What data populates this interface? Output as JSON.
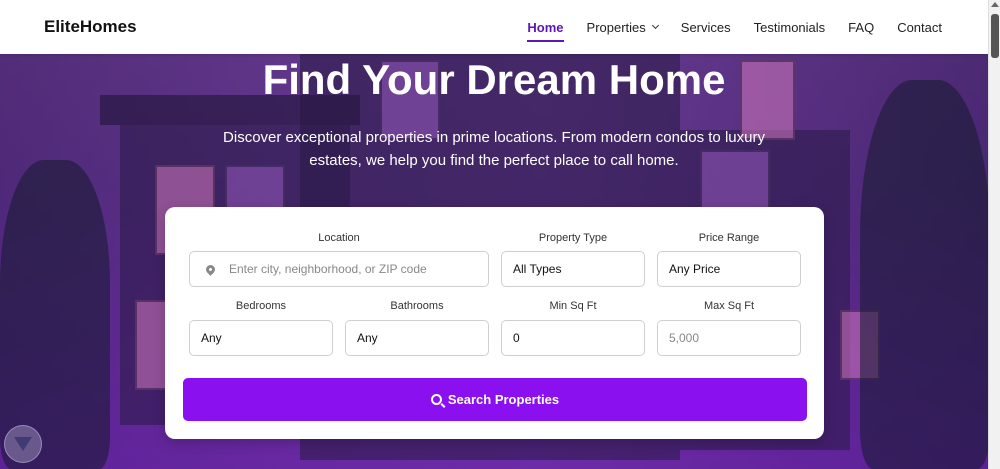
{
  "navbar": {
    "brand": "EliteHomes",
    "links": [
      {
        "label": "Home",
        "active": true
      },
      {
        "label": "Properties",
        "has_dropdown": true
      },
      {
        "label": "Services"
      },
      {
        "label": "Testimonials"
      },
      {
        "label": "FAQ"
      },
      {
        "label": "Contact"
      }
    ]
  },
  "hero": {
    "title": "Find Your Dream Home",
    "subtitle": "Discover exceptional properties in prime locations. From modern condos to luxury estates, we help you find the perfect place to call home."
  },
  "search": {
    "location": {
      "label": "Location",
      "placeholder": "Enter city, neighborhood, or ZIP code",
      "icon": "map-pin-icon"
    },
    "property_type": {
      "label": "Property Type",
      "value": "All Types"
    },
    "price_range": {
      "label": "Price Range",
      "value": "Any Price"
    },
    "bedrooms": {
      "label": "Bedrooms",
      "value": "Any"
    },
    "bathrooms": {
      "label": "Bathrooms",
      "value": "Any"
    },
    "min_sqft": {
      "label": "Min Sq Ft",
      "value": "0"
    },
    "max_sqft": {
      "label": "Max Sq Ft",
      "placeholder": "5,000"
    },
    "button": {
      "label": "Search Properties",
      "icon": "search-icon"
    }
  },
  "colors": {
    "accent": "#5b17b8",
    "button": "#8b10f0",
    "overlay": "#6a2aa0"
  }
}
